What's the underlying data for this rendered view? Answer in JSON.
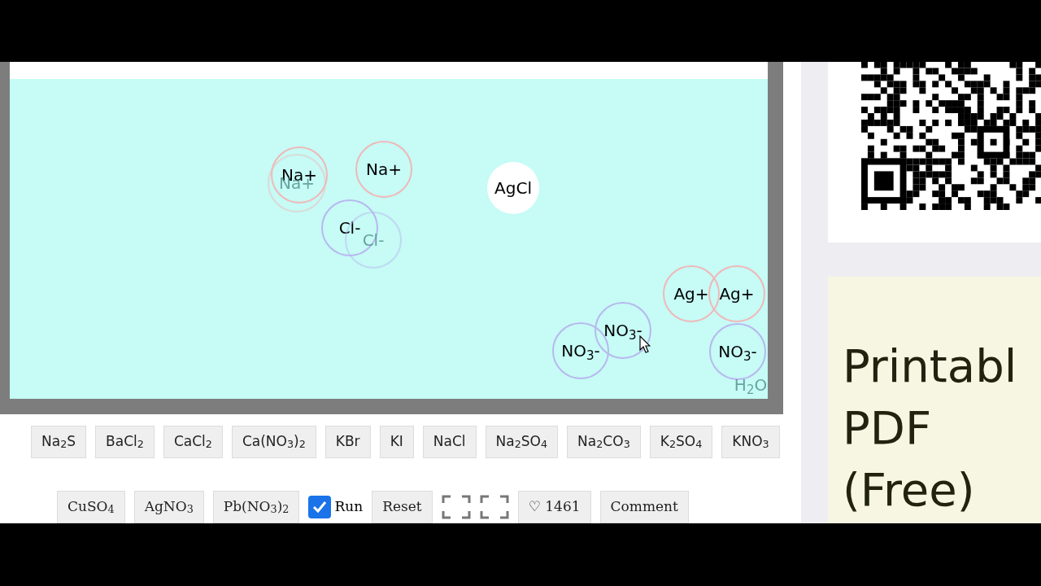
{
  "simulation": {
    "particles": [
      {
        "label": "Na+",
        "kind": "cation",
        "faded": false
      },
      {
        "label": "Na+",
        "kind": "cation",
        "faded": true
      },
      {
        "label": "Na+",
        "kind": "cation",
        "faded": false
      },
      {
        "label": "Cl-",
        "kind": "anion",
        "faded": false
      },
      {
        "label": "Cl-",
        "kind": "anion",
        "faded": true
      },
      {
        "label": "AgCl",
        "kind": "precipitate",
        "faded": false
      },
      {
        "label": "Ag+",
        "kind": "cation",
        "faded": false
      },
      {
        "label": "Ag+",
        "kind": "cation",
        "faded": false
      },
      {
        "label": "NO$_{3}$-",
        "kind": "anion",
        "faded": false
      },
      {
        "label": "NO$_{3}$-",
        "kind": "anion",
        "faded": false
      },
      {
        "label": "NO$_{3}$-",
        "kind": "anion",
        "faded": false
      },
      {
        "label": "H$_{2}$O",
        "kind": "water",
        "faded": true
      }
    ]
  },
  "compound_buttons": [
    "Na$_{2}$S",
    "BaCl$_{2}$",
    "CaCl$_{2}$",
    "Ca(NO$_{3}$)$_{2}$",
    "KBr",
    "KI",
    "NaCl",
    "Na$_{2}$SO$_{4}$",
    "Na$_{2}$CO$_{3}$",
    "K$_{2}$SO$_{4}$",
    "KNO$_{3}$"
  ],
  "controls": [
    {
      "kind": "compound",
      "label": "CuSO$_{4}$"
    },
    {
      "kind": "compound",
      "label": "AgNO$_{3}$"
    },
    {
      "kind": "compound",
      "label": "Pb(NO$_{3}$)$_{2}$"
    },
    {
      "kind": "checkbox",
      "label": "Run",
      "checked": true
    },
    {
      "kind": "button",
      "label": "Reset"
    },
    {
      "kind": "icon"
    },
    {
      "kind": "icon"
    },
    {
      "kind": "button",
      "label": "♡ 1461"
    },
    {
      "kind": "button",
      "label": "Comment"
    }
  ],
  "promo": {
    "text": "Printabl PDF (Free)"
  }
}
